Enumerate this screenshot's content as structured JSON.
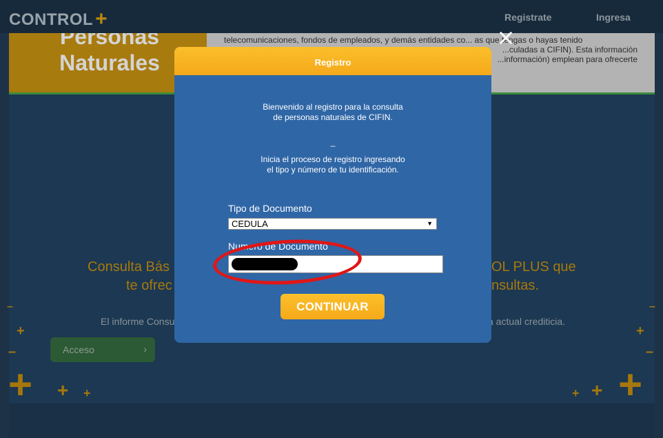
{
  "header": {
    "logo_text": "CONTROL",
    "logo_plus": "+",
    "nav": {
      "registrate": "Registrate",
      "ingresa": "Ingresa"
    }
  },
  "hero": {
    "title_line1": "Personas",
    "title_line2": "Naturales",
    "text_line1": "telecomunicaciones, fondos de empleados, y demás entidades co... as que tengas o hayas tenido",
    "text_line2": "...culadas a CIFIN). Esta información",
    "text_line3": "...información) emplean para ofrecerte"
  },
  "background": {
    "heading_left1": "Consulta Bás",
    "heading_left2": "te ofrec",
    "heading_right1": "OL PLUS",
    "heading_right_que": "que",
    "heading_right2": "nsultas.",
    "text_left": "El informe Consu",
    "text_right": "a actual crediticia.",
    "acceso_label": "Acceso",
    "acceso_chevron": "›"
  },
  "modal": {
    "close_glyph": "×",
    "title": "Registro",
    "welcome_line1": "Bienvenido al registro para la consulta",
    "welcome_line2": "de personas naturales de CIFIN.",
    "dash": "_",
    "instruct_line1": "Inicia el proceso de registro ingresando",
    "instruct_line2": "el tipo y número de tu identificación.",
    "tipo_label": "Tipo de Documento",
    "tipo_value": "CEDULA",
    "numero_label": "Numero de Documento",
    "continue_label": "CONTINUAR"
  },
  "colors": {
    "modal_bg": "#2f66a6",
    "modal_header": "#f7b023",
    "continue_btn": "#f7b023",
    "annotation_circle": "#e01717",
    "page_dimmed": "#1d3247"
  },
  "icons": {
    "close": "close-icon",
    "select_arrow": "dropdown-arrow-icon",
    "chevron": "chevron-right-icon"
  }
}
